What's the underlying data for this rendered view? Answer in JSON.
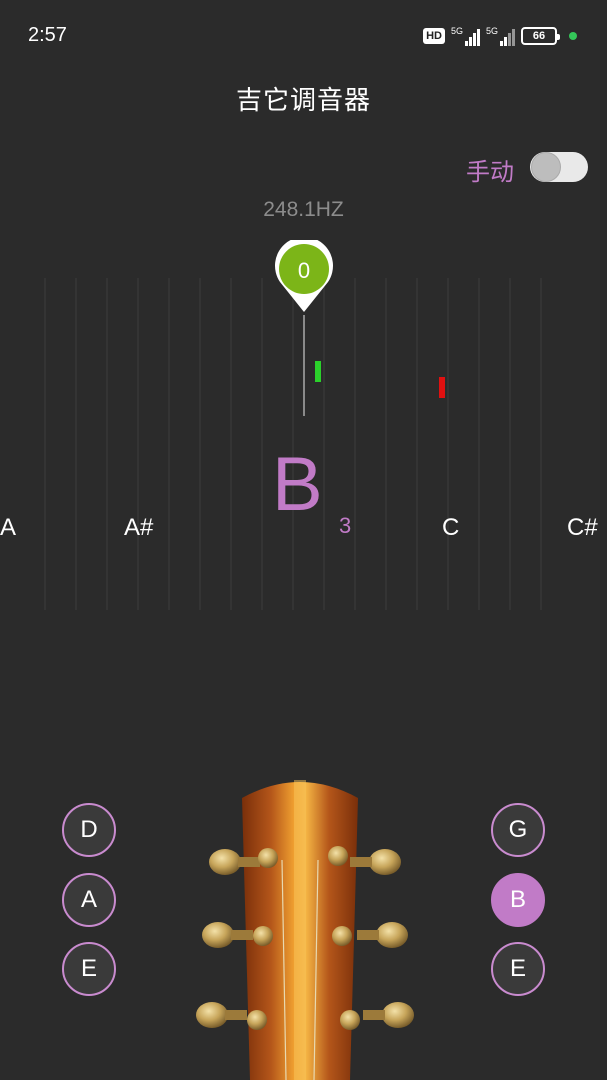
{
  "status_bar": {
    "time": "2:57",
    "hd_badge": "HD",
    "network1": "5G",
    "network2": "5G",
    "battery": "66"
  },
  "header": {
    "title": "吉它调音器"
  },
  "mode": {
    "manual_label": "手动",
    "manual_enabled": false
  },
  "tuner": {
    "frequency": "248.1HZ",
    "deviation": "0",
    "note": "B",
    "octave": "3",
    "scale_notes": [
      "A",
      "A#",
      "C",
      "C#"
    ],
    "colors": {
      "accent": "#c17bc7",
      "indicator": "#7cb518",
      "in_tune_marker": "#2bd12b",
      "target_marker": "#e01010"
    }
  },
  "strings": {
    "left": [
      "D",
      "A",
      "E"
    ],
    "right": [
      "G",
      "B",
      "E"
    ],
    "selected": "B"
  }
}
